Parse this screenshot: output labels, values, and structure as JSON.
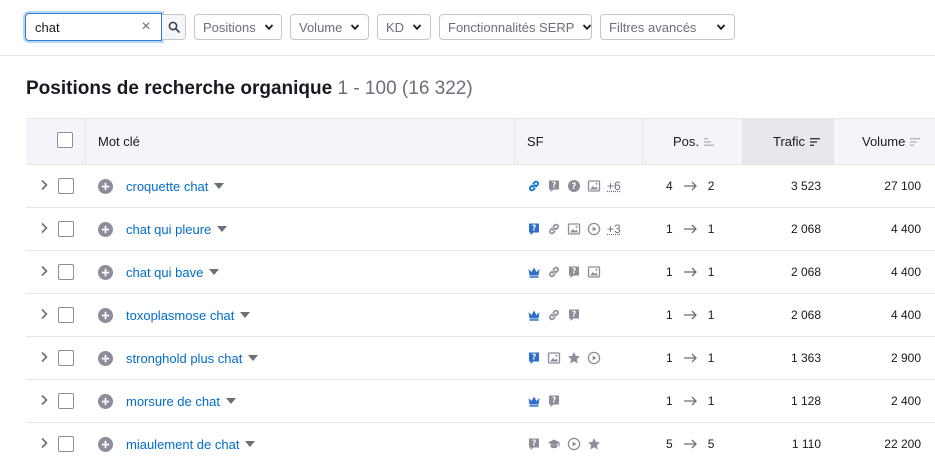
{
  "search": {
    "value": "chat",
    "clear_label": "×"
  },
  "filters": [
    {
      "label": "Positions"
    },
    {
      "label": "Volume"
    },
    {
      "label": "KD"
    },
    {
      "label": "Fonctionnalités SERP"
    },
    {
      "label": "Filtres avancés"
    }
  ],
  "heading": {
    "title": "Positions de recherche organique",
    "range": "1 - 100",
    "count": "(16 322)"
  },
  "table": {
    "columns": {
      "keyword": "Mot clé",
      "sf": "SF",
      "pos": "Pos.",
      "trafic": "Trafic",
      "volume": "Volume"
    },
    "rows": [
      {
        "keyword": "croquette chat",
        "sf": [
          "link",
          "faq",
          "question",
          "image"
        ],
        "more": "+6",
        "pos_from": "4",
        "pos_to": "2",
        "trafic": "3 523",
        "volume": "27 100"
      },
      {
        "keyword": "chat qui pleure",
        "sf": [
          "faq-blue",
          "link",
          "image",
          "video"
        ],
        "more": "+3",
        "pos_from": "1",
        "pos_to": "1",
        "trafic": "2 068",
        "volume": "4 400"
      },
      {
        "keyword": "chat qui bave",
        "sf": [
          "crown",
          "link",
          "faq",
          "image"
        ],
        "more": "",
        "pos_from": "1",
        "pos_to": "1",
        "trafic": "2 068",
        "volume": "4 400"
      },
      {
        "keyword": "toxoplasmose chat",
        "sf": [
          "crown",
          "link",
          "faq"
        ],
        "more": "",
        "pos_from": "1",
        "pos_to": "1",
        "trafic": "2 068",
        "volume": "4 400"
      },
      {
        "keyword": "stronghold plus chat",
        "sf": [
          "faq-blue",
          "image",
          "star",
          "video"
        ],
        "more": "",
        "pos_from": "1",
        "pos_to": "1",
        "trafic": "1 363",
        "volume": "2 900"
      },
      {
        "keyword": "morsure de chat",
        "sf": [
          "crown",
          "faq"
        ],
        "more": "",
        "pos_from": "1",
        "pos_to": "1",
        "trafic": "1 128",
        "volume": "2 400"
      },
      {
        "keyword": "miaulement de chat",
        "sf": [
          "faq",
          "cap",
          "video",
          "star"
        ],
        "more": "",
        "pos_from": "5",
        "pos_to": "5",
        "trafic": "1 110",
        "volume": "22 200"
      }
    ]
  },
  "colors": {
    "link": "#006dca",
    "accent_blue": "#2f7bd8",
    "icon_gray": "#8b8e99",
    "text": "#171a22"
  }
}
